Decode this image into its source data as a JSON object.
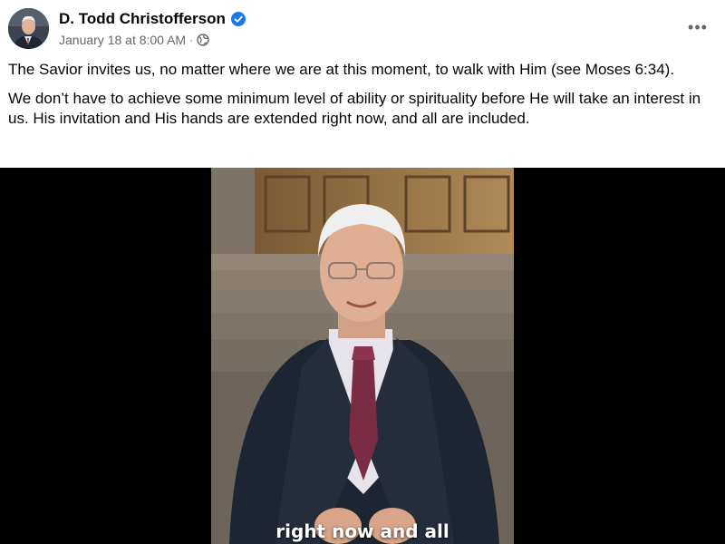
{
  "post": {
    "author": "D. Todd Christofferson",
    "timestamp": "January 18 at 8:00 AM",
    "separator": "·",
    "audience_icon": "globe-icon",
    "verified_icon": "verified-badge-icon",
    "more_icon": "more-options-icon",
    "more_label": "•••",
    "paragraphs": [
      "The Savior invites us, no matter where we are at this moment, to walk with Him (see Moses 6:34).",
      "We don’t have to achieve some minimum level of ability or spirituality before He will take an interest in us. His invitation and His hands are extended right now, and all are included."
    ]
  },
  "video": {
    "caption": "right now and all"
  },
  "colors": {
    "verified": "#1877f2",
    "secondary_text": "#65676b",
    "video_background": "#000000"
  }
}
